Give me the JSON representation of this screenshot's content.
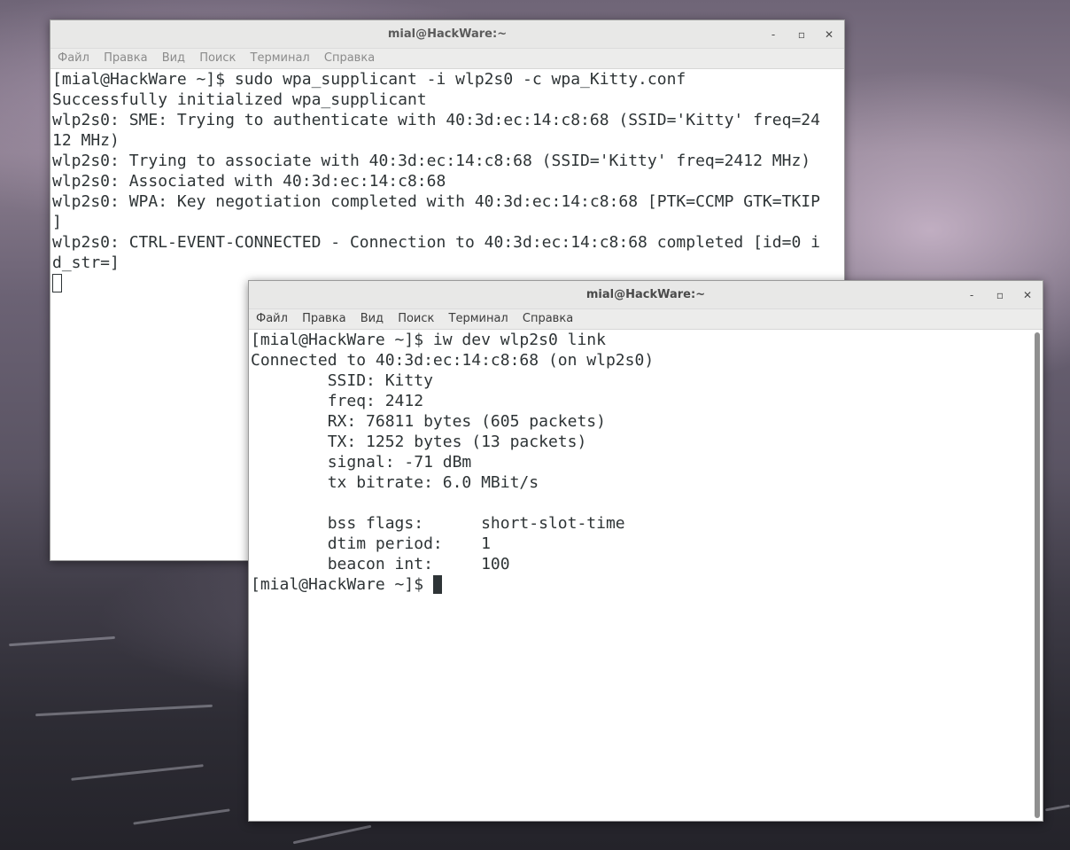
{
  "window_back": {
    "title": "mial@HackWare:~",
    "menu": [
      "Файл",
      "Правка",
      "Вид",
      "Поиск",
      "Терминал",
      "Справка"
    ],
    "lines": [
      "[mial@HackWare ~]$ sudo wpa_supplicant -i wlp2s0 -c wpa_Kitty.conf",
      "Successfully initialized wpa_supplicant",
      "wlp2s0: SME: Trying to authenticate with 40:3d:ec:14:c8:68 (SSID='Kitty' freq=24",
      "12 MHz)",
      "wlp2s0: Trying to associate with 40:3d:ec:14:c8:68 (SSID='Kitty' freq=2412 MHz)",
      "wlp2s0: Associated with 40:3d:ec:14:c8:68",
      "wlp2s0: WPA: Key negotiation completed with 40:3d:ec:14:c8:68 [PTK=CCMP GTK=TKIP",
      "]",
      "wlp2s0: CTRL-EVENT-CONNECTED - Connection to 40:3d:ec:14:c8:68 completed [id=0 i",
      "d_str=]"
    ]
  },
  "window_front": {
    "title": "mial@HackWare:~",
    "menu": [
      "Файл",
      "Правка",
      "Вид",
      "Поиск",
      "Терминал",
      "Справка"
    ],
    "lines": [
      "[mial@HackWare ~]$ iw dev wlp2s0 link",
      "Connected to 40:3d:ec:14:c8:68 (on wlp2s0)",
      "        SSID: Kitty",
      "        freq: 2412",
      "        RX: 76811 bytes (605 packets)",
      "        TX: 1252 bytes (13 packets)",
      "        signal: -71 dBm",
      "        tx bitrate: 6.0 MBit/s",
      "",
      "        bss flags:      short-slot-time",
      "        dtim period:    1",
      "        beacon int:     100"
    ],
    "prompt": "[mial@HackWare ~]$ "
  },
  "window_controls": {
    "minimize": "‐",
    "maximize": "▫",
    "close": "✕"
  },
  "icons": {
    "minimize": "minimize-icon",
    "maximize": "maximize-icon",
    "close": "close-icon"
  }
}
